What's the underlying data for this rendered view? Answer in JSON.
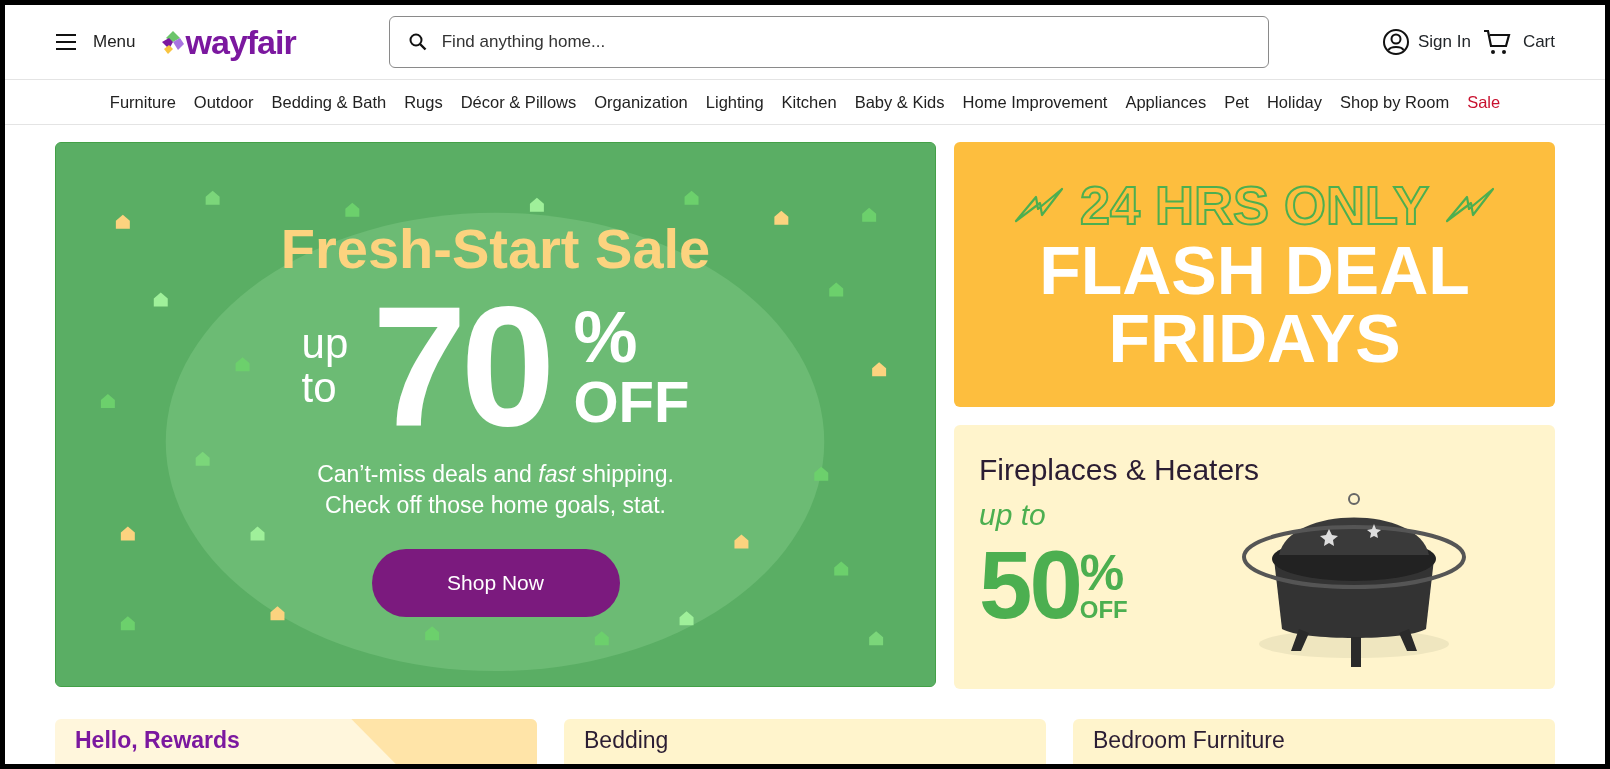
{
  "header": {
    "menu_label": "Menu",
    "logo": "wayfair",
    "search": {
      "placeholder": "Find anything home..."
    },
    "sign_in": "Sign In",
    "cart": "Cart"
  },
  "categories": [
    {
      "label": "Furniture",
      "highlighted": false
    },
    {
      "label": "Outdoor",
      "highlighted": false
    },
    {
      "label": "Bedding & Bath",
      "highlighted": false
    },
    {
      "label": "Rugs",
      "highlighted": false
    },
    {
      "label": "Décor & Pillows",
      "highlighted": false
    },
    {
      "label": "Organization",
      "highlighted": false
    },
    {
      "label": "Lighting",
      "highlighted": false
    },
    {
      "label": "Kitchen",
      "highlighted": false
    },
    {
      "label": "Baby & Kids",
      "highlighted": false
    },
    {
      "label": "Home Improvement",
      "highlighted": false
    },
    {
      "label": "Appliances",
      "highlighted": false
    },
    {
      "label": "Pet",
      "highlighted": false
    },
    {
      "label": "Holiday",
      "highlighted": false
    },
    {
      "label": "Shop by Room",
      "highlighted": false
    },
    {
      "label": "Sale",
      "highlighted": true
    }
  ],
  "hero": {
    "title": "Fresh-Start Sale",
    "up": "up",
    "to": "to",
    "amount": "70",
    "percent": "%",
    "off": "OFF",
    "lines": [
      "Can’t-miss deals and *fast* shipping.",
      "Check off those home goals, stat."
    ],
    "button": "Shop Now"
  },
  "flash_banner": {
    "tagline": "24 HRS ONLY",
    "lines": [
      "FLASH DEAL",
      "FRIDAYS"
    ]
  },
  "promo": {
    "title": "Fireplaces & Heaters",
    "up_to": "up to",
    "amount": "50",
    "percent": "%",
    "off": "OFF"
  },
  "bottom_cards": [
    {
      "title": "Hello, Rewards",
      "kind": "rewards"
    },
    {
      "title": "Bedding",
      "kind": "plain"
    },
    {
      "title": "Bedroom Furniture",
      "kind": "plain"
    }
  ]
}
